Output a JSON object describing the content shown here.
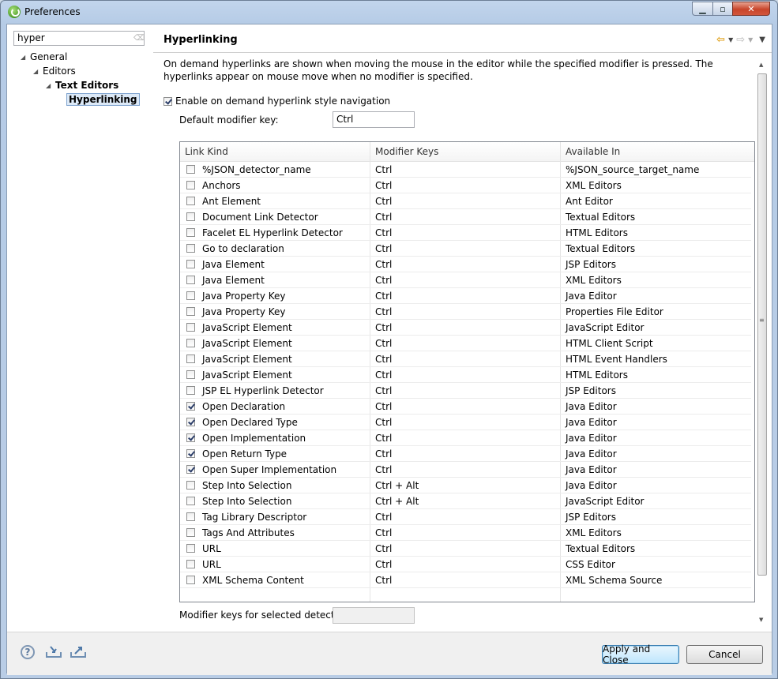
{
  "window": {
    "title": "Preferences"
  },
  "sidebar": {
    "filter_value": "hyper",
    "tree": [
      {
        "label": "General"
      },
      {
        "label": "Editors"
      },
      {
        "label": "Text Editors"
      },
      {
        "label": "Hyperlinking"
      }
    ]
  },
  "page": {
    "title": "Hyperlinking",
    "description": "On demand hyperlinks are shown when moving the mouse in the editor while the specified modifier is pressed. The hyperlinks appear on mouse move when no modifier is specified.",
    "enable_label": "Enable on demand hyperlink style navigation",
    "enable_checked": true,
    "default_modifier_label": "Default modifier key:",
    "default_modifier_value": "Ctrl",
    "table": {
      "headers": [
        "Link Kind",
        "Modifier Keys",
        "Available In"
      ],
      "rows": [
        {
          "checked": false,
          "kind": "%JSON_detector_name",
          "keys": "Ctrl",
          "available": "%JSON_source_target_name"
        },
        {
          "checked": false,
          "kind": "Anchors",
          "keys": "Ctrl",
          "available": "XML Editors"
        },
        {
          "checked": false,
          "kind": "Ant Element",
          "keys": "Ctrl",
          "available": "Ant Editor"
        },
        {
          "checked": false,
          "kind": "Document Link Detector",
          "keys": "Ctrl",
          "available": "Textual Editors"
        },
        {
          "checked": false,
          "kind": "Facelet EL Hyperlink Detector",
          "keys": "Ctrl",
          "available": "HTML Editors"
        },
        {
          "checked": false,
          "kind": "Go to declaration",
          "keys": "Ctrl",
          "available": "Textual Editors"
        },
        {
          "checked": false,
          "kind": "Java Element",
          "keys": "Ctrl",
          "available": "JSP Editors"
        },
        {
          "checked": false,
          "kind": "Java Element",
          "keys": "Ctrl",
          "available": "XML Editors"
        },
        {
          "checked": false,
          "kind": "Java Property Key",
          "keys": "Ctrl",
          "available": "Java Editor"
        },
        {
          "checked": false,
          "kind": "Java Property Key",
          "keys": "Ctrl",
          "available": "Properties File Editor"
        },
        {
          "checked": false,
          "kind": "JavaScript Element",
          "keys": "Ctrl",
          "available": "JavaScript Editor"
        },
        {
          "checked": false,
          "kind": "JavaScript Element",
          "keys": "Ctrl",
          "available": "HTML Client Script"
        },
        {
          "checked": false,
          "kind": "JavaScript Element",
          "keys": "Ctrl",
          "available": "HTML Event Handlers"
        },
        {
          "checked": false,
          "kind": "JavaScript Element",
          "keys": "Ctrl",
          "available": "HTML Editors"
        },
        {
          "checked": false,
          "kind": "JSP EL Hyperlink Detector",
          "keys": "Ctrl",
          "available": "JSP Editors"
        },
        {
          "checked": true,
          "kind": "Open Declaration",
          "keys": "Ctrl",
          "available": "Java Editor"
        },
        {
          "checked": true,
          "kind": "Open Declared Type",
          "keys": "Ctrl",
          "available": "Java Editor"
        },
        {
          "checked": true,
          "kind": "Open Implementation",
          "keys": "Ctrl",
          "available": "Java Editor"
        },
        {
          "checked": true,
          "kind": "Open Return Type",
          "keys": "Ctrl",
          "available": "Java Editor"
        },
        {
          "checked": true,
          "kind": "Open Super Implementation",
          "keys": "Ctrl",
          "available": "Java Editor"
        },
        {
          "checked": false,
          "kind": "Step Into Selection",
          "keys": "Ctrl + Alt",
          "available": "Java Editor"
        },
        {
          "checked": false,
          "kind": "Step Into Selection",
          "keys": "Ctrl + Alt",
          "available": "JavaScript Editor"
        },
        {
          "checked": false,
          "kind": "Tag Library Descriptor",
          "keys": "Ctrl",
          "available": "JSP Editors"
        },
        {
          "checked": false,
          "kind": "Tags And Attributes",
          "keys": "Ctrl",
          "available": "XML Editors"
        },
        {
          "checked": false,
          "kind": "URL",
          "keys": "Ctrl",
          "available": "Textual Editors"
        },
        {
          "checked": false,
          "kind": "URL",
          "keys": "Ctrl",
          "available": "CSS Editor"
        },
        {
          "checked": false,
          "kind": "XML Schema Content",
          "keys": "Ctrl",
          "available": "XML Schema Source"
        }
      ]
    },
    "selected_modifier_label": "Modifier keys for selected detector:",
    "selected_modifier_value": ""
  },
  "footer": {
    "apply_label": "Apply and Close",
    "cancel_label": "Cancel"
  },
  "icons": {
    "help": "help-icon",
    "import": "import-icon",
    "export": "export-icon",
    "back": "back-arrow-icon",
    "forward": "forward-arrow-icon",
    "menu": "view-menu-icon"
  },
  "colors": {
    "title_bar": "#b9cde6",
    "selection": "#dce9f7",
    "default_button": "#bee6fd"
  }
}
